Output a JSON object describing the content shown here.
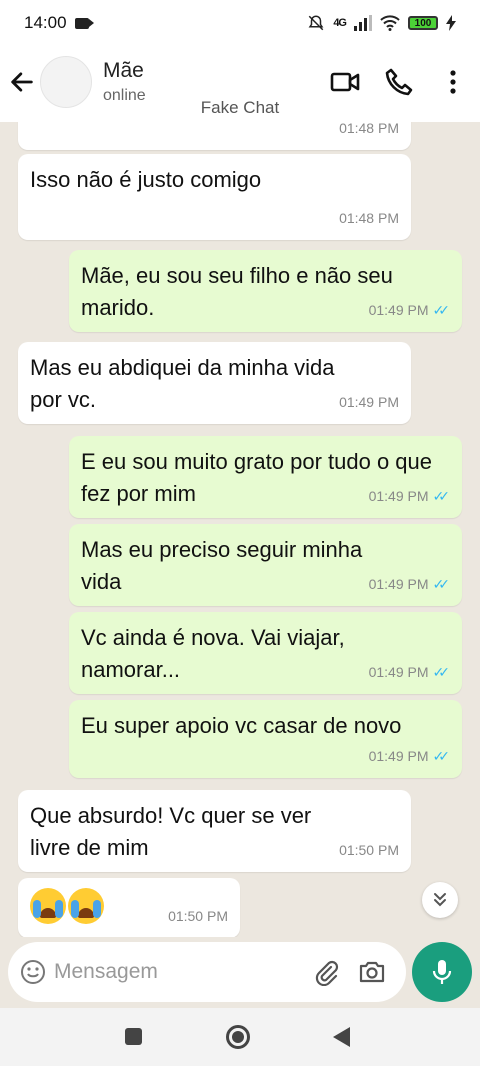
{
  "status_bar": {
    "time": "14:00",
    "network": "4G",
    "battery": "100"
  },
  "header": {
    "contact_name": "Mãe",
    "contact_status": "online",
    "watermark": "Fake Chat"
  },
  "messages": [
    {
      "dir": "in",
      "text": "",
      "time": "01:48 PM"
    },
    {
      "dir": "in",
      "text": "Isso não é justo comigo",
      "time": "01:48 PM"
    },
    {
      "dir": "out",
      "text": "Mãe, eu sou seu filho e não seu marido.",
      "time": "01:49 PM"
    },
    {
      "dir": "in",
      "text": "Mas eu abdiquei da minha vida por vc.",
      "time": "01:49 PM"
    },
    {
      "dir": "out",
      "text": "E eu sou muito grato por tudo o que fez por mim",
      "time": "01:49 PM"
    },
    {
      "dir": "out",
      "text": "Mas eu preciso seguir minha vida",
      "time": "01:49 PM"
    },
    {
      "dir": "out",
      "text": "Vc ainda é nova. Vai viajar, namorar...",
      "time": "01:49 PM"
    },
    {
      "dir": "out",
      "text": "Eu super apoio vc casar de novo",
      "time": "01:49 PM"
    },
    {
      "dir": "in",
      "text": "Que absurdo! Vc quer se ver livre de mim",
      "time": "01:50 PM"
    },
    {
      "dir": "in",
      "text": "",
      "emoji": "crying-face-emoji x2",
      "time": "01:50 PM"
    }
  ],
  "input": {
    "placeholder": "Mensagem"
  },
  "icons": {
    "back": "back-arrow-icon",
    "video": "video-call-icon",
    "phone": "phone-icon",
    "menu": "more-vert-icon",
    "emoji": "emoji-icon",
    "attach": "paperclip-icon",
    "camera": "camera-icon",
    "mic": "mic-icon",
    "scroll": "chevron-double-down-icon"
  },
  "colors": {
    "outgoing_bubble": "#e7fbd1",
    "incoming_bubble": "#ffffff",
    "chat_bg": "#ece7df",
    "accent": "#1a9e7e",
    "read_tick": "#34b7f1"
  }
}
